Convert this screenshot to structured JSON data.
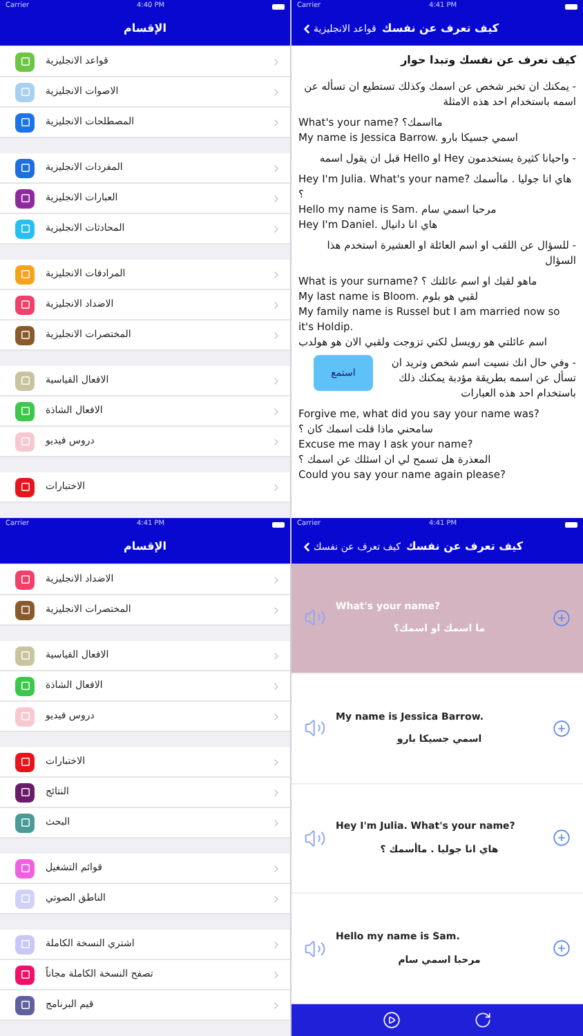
{
  "rows": [
    {
      "screens": [
        {
          "kind": "article",
          "status": {
            "carrier": "Carrier",
            "time": "4:41 PM"
          },
          "title": "كيف تعرف عن نفسك",
          "back": "قواعد الانجليزية",
          "paragraphs": [
            {
              "kind": "heading",
              "text": "كيف تعرف عن نفسك وتبدا حوار"
            },
            {
              "kind": "arabic",
              "text": "- يمكنك ان تخبر شخص عن اسمك وكذلك تستطيع ان تسأله عن اسمه باستخدام احد هذه الامثلة"
            },
            {
              "kind": "english",
              "text": "What's your name? مااسمك؟"
            },
            {
              "kind": "english",
              "text": "My name is Jessica Barrow. اسمي جسيكا بارو"
            },
            {
              "kind": "arabic",
              "text": "- واحيانا كثيرة يستخدمون Hey او Hello قبل ان يقول اسمه"
            },
            {
              "kind": "english",
              "text": "Hey I'm Julia. What's your name? هاي انا جوليا . ماأسمك ؟"
            },
            {
              "kind": "english",
              "text": "Hello my name is Sam. مرحبا اسمي سام"
            },
            {
              "kind": "english",
              "text": "Hey I'm Daniel. هاي انا دانيال"
            },
            {
              "kind": "arabic",
              "text": "- للسؤال عن اللقب او اسم العائلة او العشيرة استخدم هذا السؤال"
            },
            {
              "kind": "english",
              "text": "What is your surname? ماهو لقبك او اسم عائلتك ؟"
            },
            {
              "kind": "english",
              "text": "My last name is Bloom. لقبي هو بلوم"
            },
            {
              "kind": "english",
              "text": "My family name is Russel but I am married now so it's Holdip."
            },
            {
              "kind": "english",
              "text": "اسم عائلتي هو رويسل لكني تزوجت ولقبي الان هو هولدب"
            },
            {
              "kind": "callout",
              "button": "استمع",
              "text": "- وفي حال انك نسيت اسم شخص وتريد ان تسأل عن اسمه بطريقة مؤدبة يمكنك ذلك باستخدام احد هذه العبارات"
            },
            {
              "kind": "english",
              "text": "Forgive me, what did you say your name was?"
            },
            {
              "kind": "english",
              "text": "سامحني ماذا قلت اسمك كان ؟"
            },
            {
              "kind": "english",
              "text": "Excuse me may I ask your name?"
            },
            {
              "kind": "english",
              "text": "المعذرة هل تسمح لي ان اسئلك عن اسمك ؟"
            },
            {
              "kind": "english",
              "text": "Could you say your name again please?"
            }
          ]
        },
        {
          "kind": "menu",
          "status": {
            "carrier": "Carrier",
            "time": "4:40 PM"
          },
          "title": "الإقسام",
          "sections": [
            {
              "items": [
                {
                  "label": "قواعد الانجليزية",
                  "color": "#6cc644"
                },
                {
                  "label": "الاصوات الانجليزية",
                  "color": "#a8d0f0"
                },
                {
                  "label": "المصطلحات الانجليزية",
                  "color": "#1a73e8"
                }
              ]
            },
            {
              "items": [
                {
                  "label": "المفردات الانجليزية",
                  "color": "#1e6fe0"
                },
                {
                  "label": "العبارات الانجليزية",
                  "color": "#8e2a9e"
                },
                {
                  "label": "المحادثات الانجليزية",
                  "color": "#27c0f0"
                }
              ]
            },
            {
              "items": [
                {
                  "label": "المرادفات الانجليزية",
                  "color": "#f7a21b"
                },
                {
                  "label": "الاضداد الانجليزية",
                  "color": "#f2406a"
                },
                {
                  "label": "المختصرات الانجليزية",
                  "color": "#8b5a2b"
                }
              ]
            },
            {
              "items": [
                {
                  "label": "الافعال القياسية",
                  "color": "#c9c3a0"
                },
                {
                  "label": "الافعال الشاذة",
                  "color": "#3cc84a"
                },
                {
                  "label": "دروس فيديو",
                  "color": "#f8c8d0"
                }
              ]
            },
            {
              "items": [
                {
                  "label": "الاختبارات",
                  "color": "#e8141c"
                }
              ]
            }
          ]
        }
      ]
    },
    {
      "screens": [
        {
          "kind": "phrases",
          "status": {
            "carrier": "Carrier",
            "time": "4:41 PM"
          },
          "title": "كيف تعرف عن نفسك",
          "back": "كيف تعرف عن نفسك",
          "cards": [
            {
              "english": "What's your name?",
              "arabic": "ما اسمك او اسمك؟",
              "selected": true
            },
            {
              "english": "My name is Jessica Barrow.",
              "arabic": "اسمي جسيكا بارو",
              "selected": false
            },
            {
              "english": "Hey I'm Julia. What's your name?",
              "arabic": "هاي انا جوليا . ماأسمك ؟",
              "selected": false
            },
            {
              "english": "Hello my name is Sam.",
              "arabic": "مرحبا اسمي سام",
              "selected": false
            }
          ]
        },
        {
          "kind": "menu",
          "status": {
            "carrier": "Carrier",
            "time": "4:41 PM"
          },
          "title": "الإقسام",
          "sections": [
            {
              "items": [
                {
                  "label": "الاضداد الانجليزية",
                  "color": "#f2406a"
                },
                {
                  "label": "المختصرات الانجليزية",
                  "color": "#8b5a2b"
                }
              ]
            },
            {
              "items": [
                {
                  "label": "الافعال القياسية",
                  "color": "#c9c3a0"
                },
                {
                  "label": "الافعال الشاذة",
                  "color": "#3cc84a"
                },
                {
                  "label": "دروس فيديو",
                  "color": "#f8c8d0"
                }
              ]
            },
            {
              "items": [
                {
                  "label": "الاختبارات",
                  "color": "#e8141c"
                },
                {
                  "label": "النتائج",
                  "color": "#6a1b6a"
                },
                {
                  "label": "البحث",
                  "color": "#4a9a98"
                }
              ]
            },
            {
              "items": [
                {
                  "label": "قوائم التشغيل",
                  "color": "#f060e0"
                },
                {
                  "label": "الناطق الصوتي",
                  "color": "#d0d0f8"
                }
              ]
            },
            {
              "items": [
                {
                  "label": "اشتري النسخة الكاملة",
                  "color": "#c8c8f8"
                },
                {
                  "label": "تصفح النسخة الكاملة مجاناً",
                  "color": "#f0106a"
                },
                {
                  "label": "قيم البرنامج",
                  "color": "#6060a0"
                }
              ]
            }
          ]
        }
      ]
    }
  ]
}
